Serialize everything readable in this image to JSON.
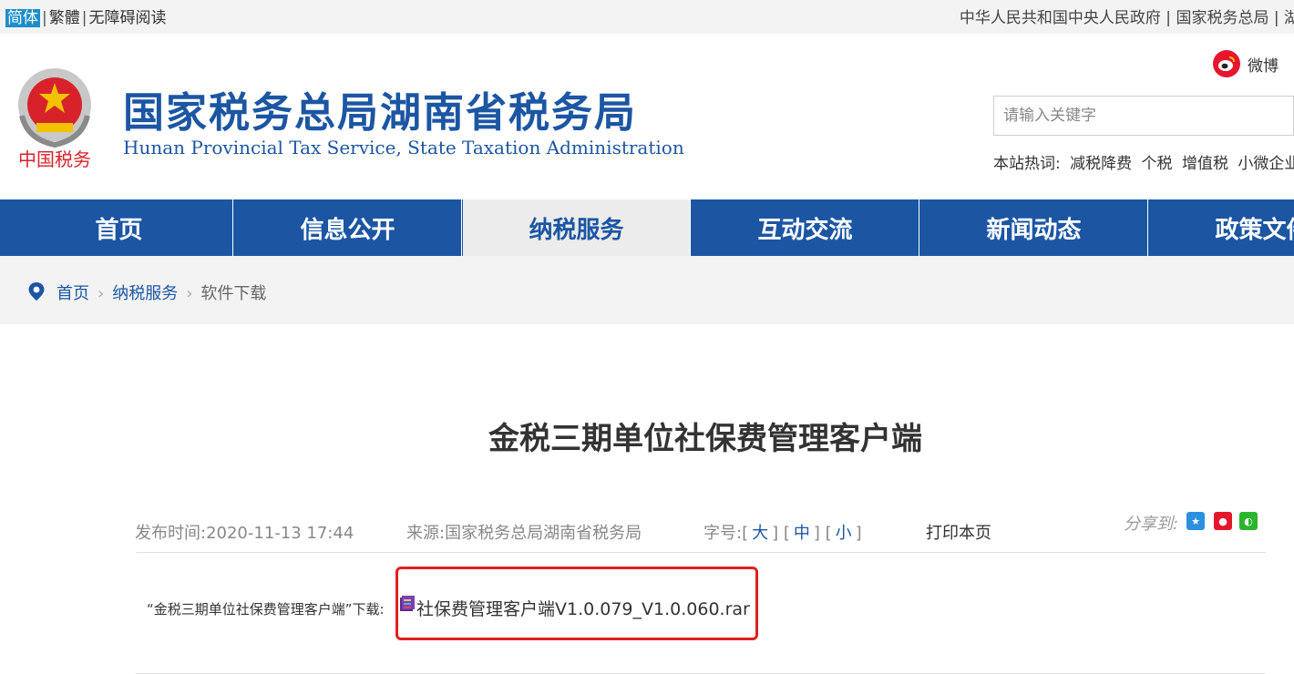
{
  "topbar": {
    "lang_simplified": "简体",
    "lang_traditional": "繁體",
    "accessibility": "无障碍阅读",
    "links": [
      "中华人民共和国中央人民政府",
      "国家税务总局",
      "湖"
    ]
  },
  "header": {
    "title": "国家税务总局湖南省税务局",
    "subtitle": "Hunan Provincial  Tax Service,  State Taxation Administration",
    "emblem_caption": "中国税务",
    "weibo_label": "微博",
    "search_placeholder": "请输入关键字",
    "hot_label": "本站热词:",
    "hot_words": [
      "减税降费",
      "个税",
      "增值税",
      "小微企业"
    ]
  },
  "nav": {
    "items": [
      "首页",
      "信息公开",
      "纳税服务",
      "互动交流",
      "新闻动态",
      "政策文件"
    ],
    "active_index": 2
  },
  "breadcrumb": {
    "home": "首页",
    "section": "纳税服务",
    "current": "软件下载"
  },
  "article": {
    "title": "金税三期单位社保费管理客户端",
    "publish_label": "发布时间:",
    "publish_time": "2020-11-13 17:44",
    "source_label": "来源:",
    "source": "国家税务总局湖南省税务局",
    "fontsize_label": "字号:",
    "size_large": "大",
    "size_medium": "中",
    "size_small": "小",
    "print_label": "打印本页",
    "share_label": "分享到:",
    "download_label": "“金税三期单位社保费管理客户端”下载:",
    "download_file": "社保费管理客户端V1.0.079_V1.0.060.rar"
  },
  "colors": {
    "brand_blue": "#1c56a3",
    "highlight_red": "#e02020",
    "active_lang": "#1a8fc9"
  }
}
